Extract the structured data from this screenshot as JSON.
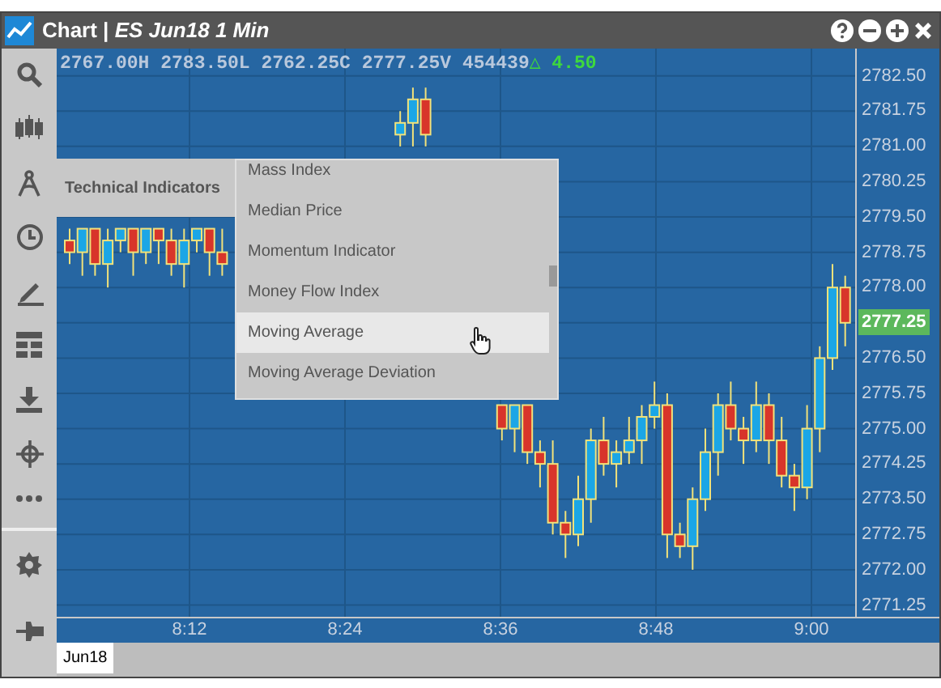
{
  "window": {
    "title": "Chart | *ES Jun18 1 Min*"
  },
  "header": {
    "quote": "2767.00H 2783.50L 2762.25C 2777.25V 454439",
    "change": "△ 4.50"
  },
  "time_axis": [
    "8:12",
    "8:24",
    "8:36",
    "8:48",
    "9:00"
  ],
  "menu": {
    "label": "Technical Indicators",
    "items": [
      {
        "label": "Mass Index",
        "selected": false
      },
      {
        "label": "Median Price",
        "selected": false
      },
      {
        "label": "Momentum Indicator",
        "selected": false
      },
      {
        "label": "Money Flow Index",
        "selected": false
      },
      {
        "label": "Moving Average",
        "selected": true
      },
      {
        "label": "Moving Average Deviation",
        "selected": false
      }
    ]
  },
  "bottom_bar": {
    "tab": "Jun18"
  },
  "chart_data": {
    "type": "candlestick",
    "grid": true,
    "ylim": [
      2771.0,
      2783.08
    ],
    "categories": [
      null,
      null,
      null,
      null,
      null,
      null,
      null,
      null,
      null,
      null,
      null,
      null,
      null,
      null,
      null,
      null,
      null,
      null,
      null,
      null,
      null,
      null,
      null,
      null,
      null,
      null,
      null,
      null,
      null,
      null,
      null,
      null,
      null,
      null,
      null,
      null,
      null,
      null,
      null,
      null,
      null,
      null,
      null,
      null,
      null,
      null,
      null,
      null,
      null,
      null,
      null,
      null,
      null,
      null,
      null,
      null,
      null,
      null,
      null,
      null,
      null,
      null
    ],
    "yticks": [
      {
        "value": 2782.5,
        "label": "2782.50"
      },
      {
        "value": 2781.75,
        "label": "2781.75"
      },
      {
        "value": 2781,
        "label": "2781.00"
      },
      {
        "value": 2780.25,
        "label": "2780.25"
      },
      {
        "value": 2779.5,
        "label": "2779.50"
      },
      {
        "value": 2778.75,
        "label": "2778.75"
      },
      {
        "value": 2778,
        "label": "2778.00"
      },
      {
        "value": 2777.25,
        "label": "2777.25"
      },
      {
        "value": 2776.5,
        "label": "2776.50"
      },
      {
        "value": 2775.75,
        "label": "2775.75"
      },
      {
        "value": 2775,
        "label": "2775.00"
      },
      {
        "value": 2774.25,
        "label": "2774.25"
      },
      {
        "value": 2773.5,
        "label": "2773.50"
      },
      {
        "value": 2772.75,
        "label": "2772.75"
      },
      {
        "value": 2772,
        "label": "2772.00"
      },
      {
        "value": 2771.25,
        "label": "2771.25"
      }
    ],
    "ohlc": [
      [
        2779.0,
        2779.25,
        2778.5,
        2778.75
      ],
      [
        2778.75,
        2779.25,
        2778.25,
        2779.25
      ],
      [
        2779.25,
        2779.25,
        2778.25,
        2778.5
      ],
      [
        2778.5,
        2779.25,
        2778.0,
        2779.0
      ],
      [
        2779.0,
        2779.25,
        2778.75,
        2779.25
      ],
      [
        2779.25,
        2779.25,
        2778.25,
        2778.75
      ],
      [
        2778.75,
        2779.25,
        2778.5,
        2779.25
      ],
      [
        2779.25,
        2779.25,
        2778.5,
        2779.0
      ],
      [
        2779.0,
        2779.25,
        2778.25,
        2778.5
      ],
      [
        2778.5,
        2779.25,
        2778.0,
        2779.0
      ],
      [
        2779.0,
        2779.25,
        2778.75,
        2779.25
      ],
      [
        2779.25,
        2779.25,
        2778.25,
        2778.75
      ],
      [
        2778.75,
        2779.25,
        2778.25,
        2778.5
      ],
      null,
      null,
      null,
      null,
      null,
      null,
      null,
      null,
      null,
      null,
      null,
      null,
      null,
      [
        2781.25,
        2781.75,
        2781.0,
        2781.5
      ],
      [
        2781.5,
        2782.25,
        2781.0,
        2782.0
      ],
      [
        2782.0,
        2782.25,
        2781.0,
        2781.25
      ],
      null,
      null,
      null,
      null,
      null,
      [
        2775.5,
        2775.5,
        2774.75,
        2775.0
      ],
      [
        2775.0,
        2775.5,
        2774.5,
        2775.5
      ],
      [
        2775.5,
        2775.5,
        2774.25,
        2774.5
      ],
      [
        2774.5,
        2774.75,
        2773.75,
        2774.25
      ],
      [
        2774.25,
        2774.75,
        2772.75,
        2773.0
      ],
      [
        2773.0,
        2773.25,
        2772.25,
        2772.75
      ],
      [
        2772.75,
        2774.0,
        2772.5,
        2773.5
      ],
      [
        2773.5,
        2775.0,
        2773.0,
        2774.75
      ],
      [
        2774.75,
        2775.25,
        2774.0,
        2774.25
      ],
      [
        2774.25,
        2774.75,
        2773.75,
        2774.5
      ],
      [
        2774.5,
        2775.25,
        2774.25,
        2774.75
      ],
      [
        2774.75,
        2775.5,
        2774.25,
        2775.25
      ],
      [
        2775.25,
        2776.0,
        2775.0,
        2775.5
      ],
      [
        2775.5,
        2775.75,
        2772.25,
        2772.75
      ],
      [
        2772.75,
        2773.0,
        2772.25,
        2772.5
      ],
      [
        2772.5,
        2773.75,
        2772.0,
        2773.5
      ],
      [
        2773.5,
        2775.0,
        2773.25,
        2774.5
      ],
      [
        2774.5,
        2775.75,
        2774.0,
        2775.5
      ],
      [
        2775.5,
        2776.0,
        2774.75,
        2775.0
      ],
      [
        2775.0,
        2775.25,
        2774.25,
        2774.75
      ],
      [
        2774.75,
        2776.0,
        2774.5,
        2775.5
      ],
      [
        2775.5,
        2775.75,
        2774.25,
        2774.75
      ],
      [
        2774.75,
        2775.25,
        2773.75,
        2774.0
      ],
      [
        2774.0,
        2774.25,
        2773.25,
        2773.75
      ],
      [
        2773.75,
        2775.5,
        2773.5,
        2775.0
      ],
      [
        2775.0,
        2776.75,
        2774.5,
        2776.5
      ],
      [
        2776.5,
        2778.5,
        2776.25,
        2778.0
      ],
      [
        2778.0,
        2778.25,
        2776.75,
        2777.25
      ]
    ]
  }
}
